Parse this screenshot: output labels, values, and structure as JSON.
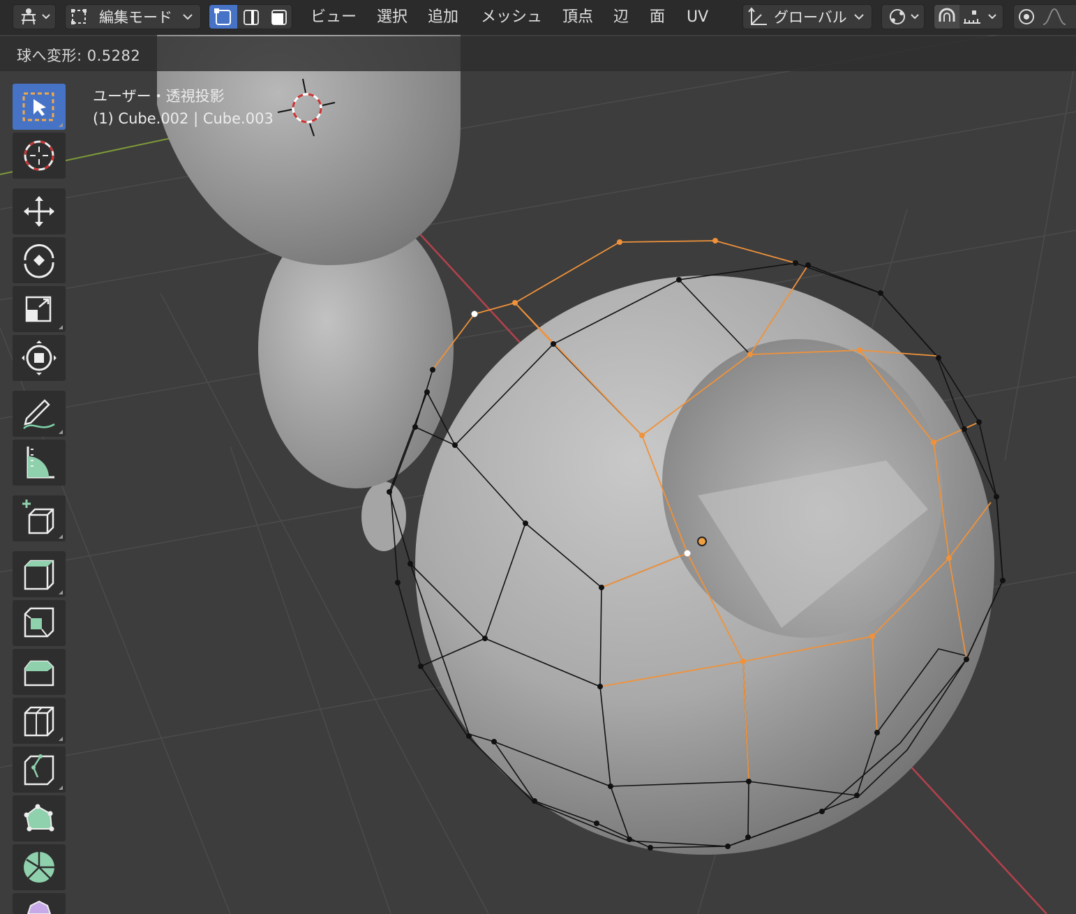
{
  "header": {
    "editor_type_icon": "3d-viewport-icon",
    "mode_label": "編集モード",
    "select_modes": [
      "vertex-select",
      "edge-select",
      "face-select"
    ],
    "menus": [
      "ビュー",
      "選択",
      "追加",
      "メッシュ",
      "頂点",
      "辺",
      "面",
      "UV"
    ],
    "transform_orientation_label": "グローバル",
    "pivot_icon": "pivot-point-icon",
    "snap_icon": "snap-magnet-icon",
    "snap_target_icon": "snap-increment-icon",
    "proportional_icon": "proportional-edit-icon",
    "falloff_icon": "falloff-curve-icon"
  },
  "operator": {
    "label": "球へ変形: 0.5282"
  },
  "viewport": {
    "view_name": "ユーザー・透視投影",
    "object_info": "(1) Cube.002 | Cube.003"
  },
  "toolbar": {
    "tools": [
      {
        "name": "select-box",
        "icon": "select-box-icon",
        "active": true
      },
      {
        "name": "cursor",
        "icon": "cursor-icon"
      },
      {
        "name": "move",
        "icon": "move-icon"
      },
      {
        "name": "rotate",
        "icon": "rotate-icon"
      },
      {
        "name": "scale",
        "icon": "scale-icon"
      },
      {
        "name": "transform",
        "icon": "transform-icon"
      },
      {
        "name": "annotate",
        "icon": "annotate-icon"
      },
      {
        "name": "measure",
        "icon": "measure-icon"
      },
      {
        "name": "add-cube",
        "icon": "add-cube-icon"
      },
      {
        "name": "extrude",
        "icon": "extrude-icon"
      },
      {
        "name": "inset",
        "icon": "inset-icon"
      },
      {
        "name": "bevel",
        "icon": "bevel-icon"
      },
      {
        "name": "loop-cut",
        "icon": "loop-cut-icon"
      },
      {
        "name": "knife",
        "icon": "knife-icon"
      },
      {
        "name": "poly-build",
        "icon": "poly-build-icon"
      },
      {
        "name": "spin",
        "icon": "spin-icon"
      },
      {
        "name": "smooth",
        "icon": "smooth-icon"
      }
    ]
  },
  "colors": {
    "viewport_bg": "#3d3d3d",
    "header_bg": "#2b2b2b",
    "active_tool": "#4673c6",
    "selected_edge": "#f0923a",
    "axis_x": "#b5414c",
    "axis_y": "#7e9b38"
  }
}
